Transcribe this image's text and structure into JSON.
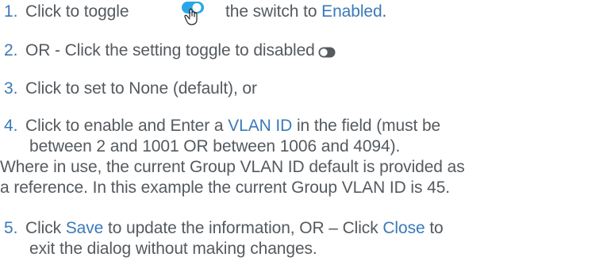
{
  "steps": [
    {
      "num": "1.",
      "parts": [
        "Click to toggle",
        "the switch to",
        "Enabled",
        "."
      ]
    },
    {
      "num": "2.",
      "parts": [
        "OR - Click the setting toggle to disabled"
      ]
    },
    {
      "num": "3.",
      "parts": [
        "Click to set to None (default), or"
      ]
    },
    {
      "num": "4.",
      "parts": [
        "Click to enable and Enter a",
        "VLAN ID",
        "in the field (must be",
        "between 2 and 1001 OR between 1006 and 4094)."
      ]
    },
    {
      "num": "5.",
      "parts": [
        "Click",
        "Save",
        "to update the information, OR – Click",
        "Close",
        "to",
        "exit the dialog without making changes."
      ]
    }
  ],
  "note": [
    "Where in use, the current Group VLAN ID default is provided as",
    "a reference. In this example the current Group VLAN ID is 45."
  ],
  "colors": {
    "text": "#555a5f",
    "accent": "#3a7ab8",
    "toggle_on": "#2aa6e8",
    "toggle_off": "#555a5f"
  },
  "icons": {
    "toggle_enabled": "toggle-on-with-hand-cursor-icon",
    "toggle_disabled": "toggle-off-icon"
  }
}
